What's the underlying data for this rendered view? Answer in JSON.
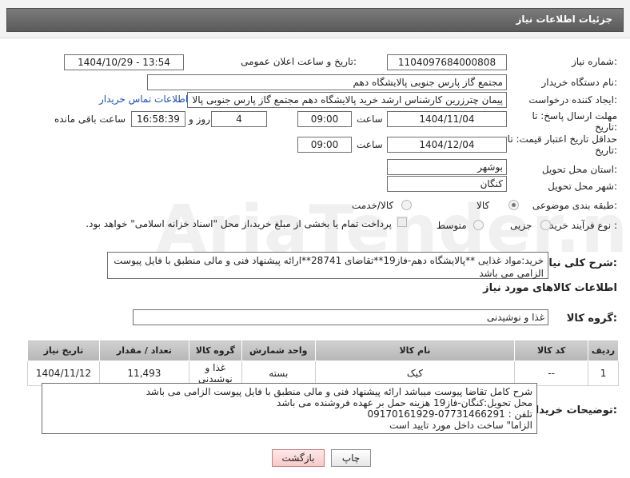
{
  "header": {
    "title": "جزئیات اطلاعات نیاز"
  },
  "watermark": "AriaTender.net",
  "fields": {
    "need_number": {
      "label": "شماره نیاز:",
      "value": "1104097684000808"
    },
    "announce_datetime": {
      "label": "تاریخ و ساعت اعلان عمومی:",
      "value": "1404/10/29 - 13:54"
    },
    "buyer_org": {
      "label": "نام دستگاه خریدار:",
      "value": "مجتمع گاز پارس جنوبی  پالایشگاه دهم"
    },
    "requester": {
      "label": "ایجاد کننده درخواست:",
      "value": "پیمان چترزرین کارشناس ارشد خرید پالایشگاه دهم مجتمع گاز پارس جنوبی  پالا",
      "contact_link": "اطلاعات تماس خریدار"
    },
    "response_deadline": {
      "label": "مهلت ارسال پاسخ: تا تاریخ:",
      "date": "1404/11/04",
      "time_label": "ساعت",
      "time": "09:00",
      "days": "4",
      "days_label": "روز و",
      "remaining": "16:58:39",
      "remaining_label": "ساعت باقی مانده"
    },
    "price_validity": {
      "label": "حداقل تاریخ اعتبار قیمت: تا تاریخ:",
      "date": "1404/12/04",
      "time_label": "ساعت",
      "time": "09:00"
    },
    "province": {
      "label": "استان محل تحویل:",
      "value": "بوشهر"
    },
    "city": {
      "label": "شهر محل تحویل:",
      "value": "کنگان"
    },
    "category": {
      "label": "طبقه بندی موضوعی:",
      "options": [
        "کالا",
        "کالا/خدمت"
      ],
      "selected": "کالا"
    },
    "process_type": {
      "label": "نوع فرآیند خرید :",
      "options": [
        "جزیی",
        "متوسط"
      ],
      "selected": "جزیی",
      "payment_note": "پرداخت تمام یا بخشی از مبلغ خرید،از محل \"اسناد خزانه اسلامی\" خواهد بود."
    }
  },
  "general_description": {
    "label": "شرح کلی نیاز:",
    "line1": "خرید:مواد غذایی **پالایشگاه دهم-فاز19**تقاضای 28741**ارائه پیشنهاد فنی و مالی منطبق با فایل پیوست",
    "line2": "الزامی می باشد"
  },
  "goods_info": {
    "title": "اطلاعات کالاهای مورد نیاز",
    "group_label": "گروه کالا:",
    "group_value": "غذا و نوشیدنی"
  },
  "table": {
    "headers": [
      "ردیف",
      "کد کالا",
      "نام کالا",
      "واحد شمارش",
      "گروه کالا",
      "تعداد / مقدار",
      "تاریخ نیاز"
    ],
    "rows": [
      [
        "1",
        "--",
        "کیک",
        "بسته",
        "غذا و نوشیدنی",
        "11,493",
        "1404/11/12"
      ]
    ]
  },
  "buyer_notes": {
    "label": "توضیحات خریدار:",
    "lines": [
      "شرح کامل تقاضا پیوست میباشد ارائه پیشنهاد فنی و مالی منطبق با فایل پیوست الزامی می باشد",
      "محل تحویل:کنگان-فاز19 هزینه حمل بر عهده فروشنده می باشد",
      "تلفن : 07731466291-09170161929",
      "الزاما\" ساخت داخل مورد تایید است"
    ]
  },
  "buttons": {
    "print": "چاپ",
    "back": "بازگشت"
  }
}
